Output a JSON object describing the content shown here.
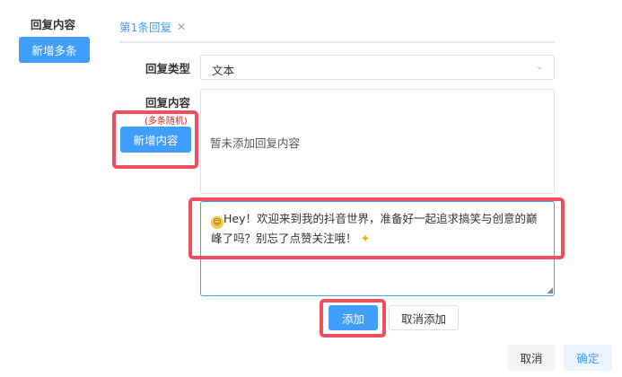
{
  "left_panel": {
    "title": "回复内容",
    "add_multiple_button": "新增多条"
  },
  "tabs": [
    {
      "label": "第1条回复",
      "active": true
    }
  ],
  "form": {
    "reply_type_label": "回复类型",
    "reply_type_value": "文本",
    "reply_content_label": "回复内容",
    "random_hint": "(多条随机)",
    "add_content_button": "新增内容",
    "empty_text": "暂未添加回复内容",
    "input_line1": "Hey！欢迎来到我的抖音世界，准备好一起追求搞笑与创意的巅",
    "input_line2": "峰了吗？别忘了点赞关注哦！",
    "add_button": "添加",
    "cancel_add_button": "取消添加"
  },
  "footer": {
    "cancel_button": "取消",
    "confirm_button": "确定"
  },
  "colors": {
    "primary": "#409eff",
    "highlight": "#f04d5e",
    "hint_red": "#e02020"
  },
  "icons": {
    "tab_close": "close-icon",
    "select_arrow": "chevron-down-icon",
    "smile": "smile-emoji-icon",
    "sparkle": "sparkle-emoji-icon"
  }
}
